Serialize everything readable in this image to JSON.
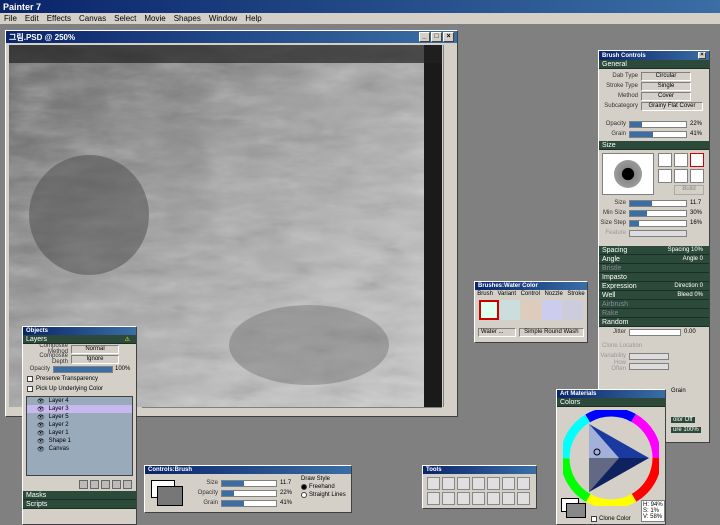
{
  "app": {
    "title": "Painter 7"
  },
  "menubar": {
    "items": [
      "File",
      "Edit",
      "Effects",
      "Canvas",
      "Select",
      "Movie",
      "Shapes",
      "Window",
      "Help"
    ]
  },
  "doc": {
    "title": "그림.PSD @ 250%"
  },
  "brush_controls": {
    "title": "Brush Controls",
    "general": "General",
    "dab_type_label": "Dab Type",
    "dab_type": "Circular",
    "stroke_type_label": "Stroke Type",
    "stroke_type": "Single",
    "method_label": "Method",
    "method": "Cover",
    "subcategory_label": "Subcategory",
    "subcategory": "Grainy Flat Cover",
    "opacity_label": "Opacity",
    "opacity": "22%",
    "opacity_pct": 22,
    "grain_label": "Grain",
    "grain": "41%",
    "grain_pct": 41,
    "size_sec": "Size",
    "build": "Build",
    "size_label": "Size",
    "size": "11.7",
    "size_pct": 40,
    "minsize_label": "Min Size",
    "minsize": "30%",
    "minsize_pct": 30,
    "sizestep_label": "Size Step",
    "sizestep": "16%",
    "sizestep_pct": 16,
    "feature_label": "Feature",
    "spacing": "Spacing",
    "spacing_r": "Spacing 10%",
    "angle": "Angle",
    "angle_r": "Angle 0",
    "bristle": "Bristle",
    "impasto": "Impasto",
    "expression": "Expression",
    "expression_r": "Direction 0",
    "well": "Well",
    "well_r": "Bleed 0%",
    "airbrush": "Airbrush",
    "rake": "Rake",
    "random": "Random",
    "jitter_label": "Jitter",
    "jitter": "0.00",
    "clone_location": "Clone Location",
    "variability_label": "Variability",
    "how_often_label": "How Often",
    "grain_frag": "Grain",
    "color_off": "olor Off",
    "ure": "ure 100%"
  },
  "brushes": {
    "title": "Brushes:Water Color",
    "menu": [
      "Brush",
      "Variant",
      "Control",
      "Nozzle",
      "Stroke"
    ],
    "category": "Water ...",
    "variant": "Simple Round Wash"
  },
  "objects": {
    "title": "Objects",
    "layers": "Layers",
    "composite_method_label": "Composite Method",
    "composite_method": "Normal",
    "composite_depth_label": "Composite Depth",
    "composite_depth": "Ignore",
    "opacity_label": "Opacity",
    "opacity": "100%",
    "preserve": "Preserve Transparency",
    "pickup": "Pick Up Underlying Color",
    "layer_items": [
      "Layer 4",
      "Layer 3",
      "Layer 5",
      "Layer 2",
      "Layer 1",
      "Shape 1",
      "Canvas"
    ],
    "masks": "Masks",
    "scripts": "Scripts"
  },
  "controls": {
    "title": "Controls:Brush",
    "size_label": "Size",
    "size": "11.7",
    "opacity_label": "Opacity",
    "opacity": "22%",
    "grain_label": "Grain",
    "grain": "41%",
    "draw_style": "Draw Style",
    "freehand": "Freehand",
    "straight": "Straight Lines"
  },
  "tools": {
    "title": "Tools"
  },
  "art": {
    "title": "Art Materials",
    "colors": "Colors",
    "h": "H: 94%",
    "s": "S: 1%",
    "v": "V: 58%",
    "clone_color": "Clone Color"
  }
}
